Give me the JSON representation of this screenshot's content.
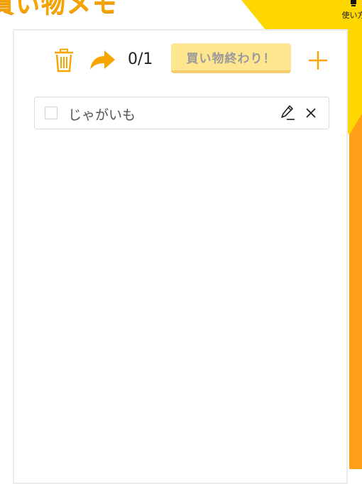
{
  "app": {
    "title": "買い物メモ",
    "help_label": "使い方"
  },
  "toolbar": {
    "trash_icon": "trash-icon",
    "share_icon": "share-forward-icon",
    "counter": "0/1",
    "done_label": "買い物終わり！",
    "add_icon": "plus-icon"
  },
  "items": [
    {
      "label": "じゃがいも",
      "checked": false
    }
  ],
  "colors": {
    "accent": "#f5a400",
    "yellow": "#ffd700",
    "orange": "#ff9f1a",
    "button_bg": "#fde68f",
    "button_text": "#9a9a9a"
  }
}
